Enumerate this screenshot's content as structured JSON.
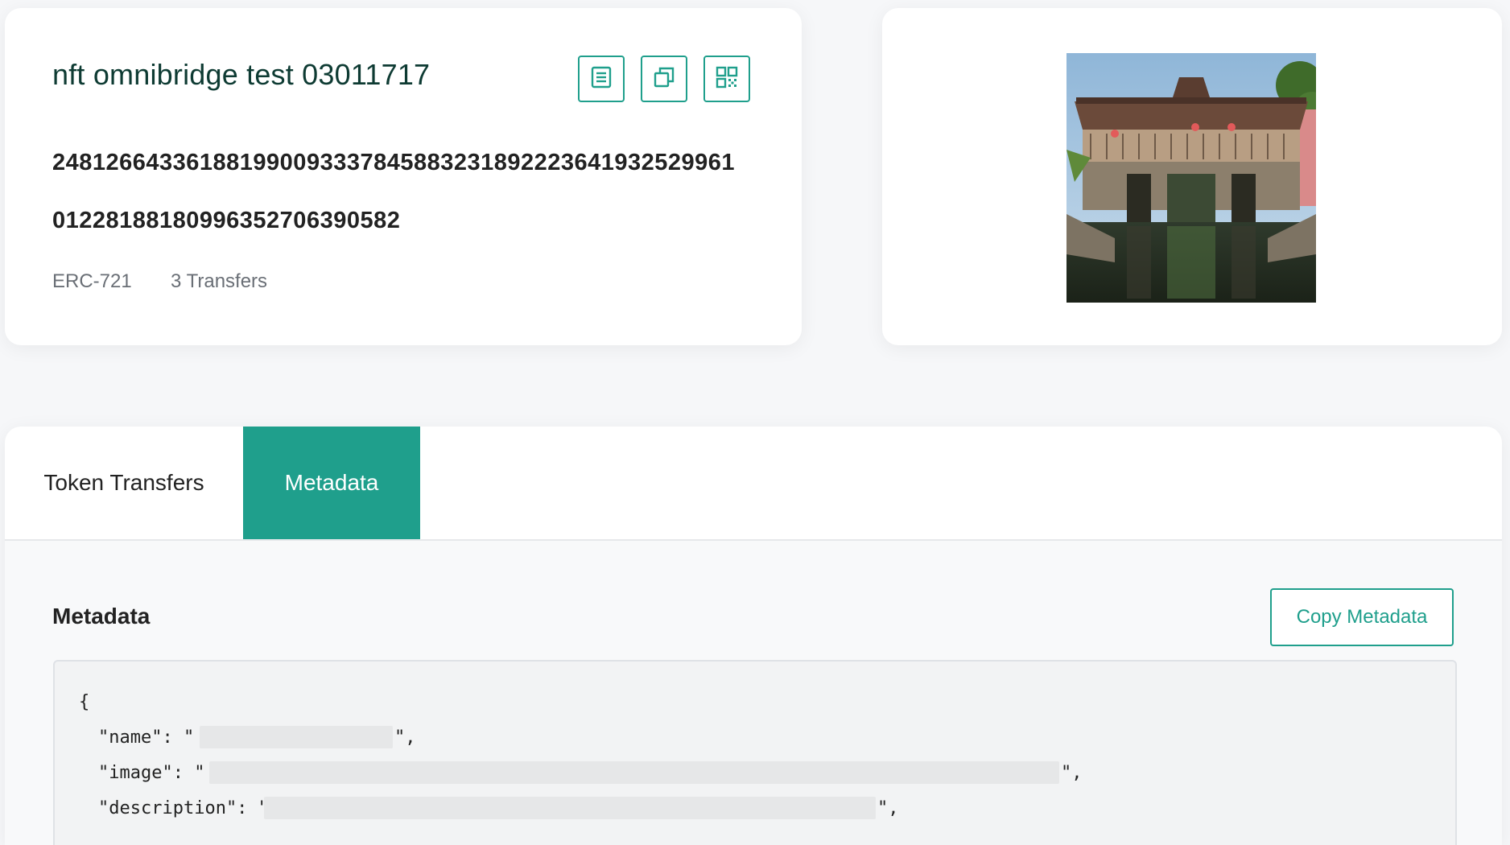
{
  "token": {
    "title": "nft omnibridge test 03011717",
    "id_line_1": "24812664336188199009333784588323189222364193252996​1",
    "id_line_2": "0122818818099635270639058​2",
    "standard": "ERC-721",
    "transfers": "3 Transfers"
  },
  "icons": {
    "details": "list-details-icon",
    "copy": "copy-icon",
    "qr": "qr-code-icon"
  },
  "tabs": [
    {
      "label": "Token Transfers",
      "active": false
    },
    {
      "label": "Metadata",
      "active": true
    }
  ],
  "metadata_section": {
    "title": "Metadata",
    "copy_label": "Copy Metadata",
    "open_brace": "{",
    "name_prefix": "\"name\": \"",
    "name_suffix": "\",",
    "image_prefix": "\"image\": \"",
    "image_suffix": "\",",
    "description_prefix": "\"description\": \"",
    "description_suffix": "\","
  },
  "colors": {
    "accent": "#1f9f8c",
    "title": "#0e3b33"
  }
}
